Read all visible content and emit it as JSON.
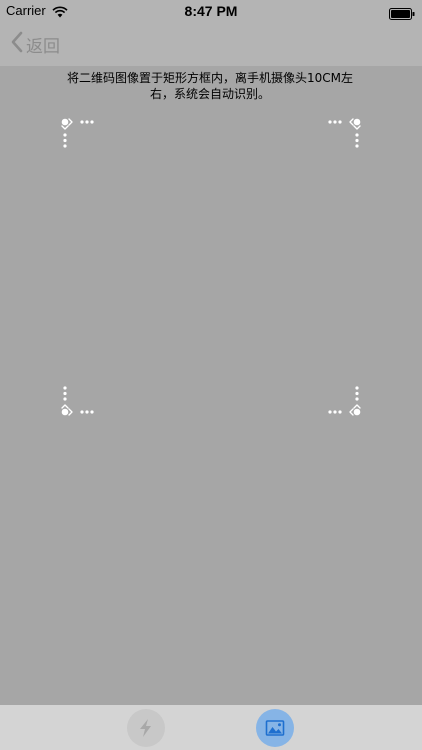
{
  "status_bar": {
    "carrier": "Carrier",
    "time": "8:47 PM",
    "wifi_icon": "wifi-icon",
    "battery_icon": "battery-icon"
  },
  "nav": {
    "back_label": "返回",
    "back_icon": "chevron-left-icon"
  },
  "scanner": {
    "instruction_line1": "将二维码图像置于矩形方框内，离手机摄像头10CM左",
    "instruction_line2": "右，系统会自动识别。"
  },
  "bottom_bar": {
    "flash_icon": "lightning-icon",
    "photo_icon": "image-icon",
    "photo_button_color": "#86b4e6"
  }
}
